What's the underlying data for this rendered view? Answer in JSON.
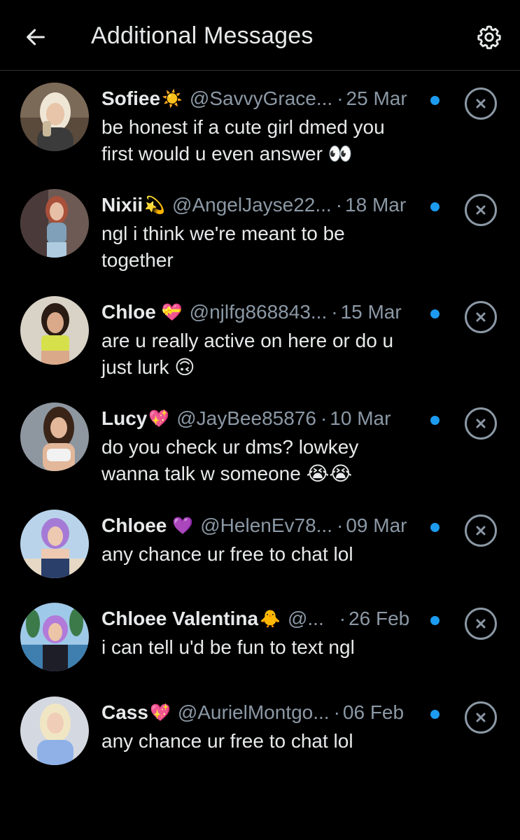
{
  "header": {
    "title": "Additional Messages",
    "back_icon": "arrow-left-icon",
    "settings_icon": "gear-icon"
  },
  "colors": {
    "background": "#000000",
    "text": "#e7e9ea",
    "secondary": "#8b98a5",
    "unread": "#1d9bf0"
  },
  "messages": [
    {
      "name": "Sofiee",
      "emoji": "☀️",
      "handle": "@SavvyGrace...",
      "date": "25 Mar",
      "text": "be honest if a cute girl dmed you first would u even answer 👀",
      "unread": true
    },
    {
      "name": "Nixii",
      "emoji": "💫",
      "handle": "@AngelJayse22...",
      "date": "18 Mar",
      "text": "ngl i think we're meant to be together",
      "unread": true
    },
    {
      "name": "Chloe",
      "emoji": "💝",
      "handle": "@njlfg868843...",
      "date": "15 Mar",
      "text": "are u really active on here or do u just lurk 🙃",
      "unread": true
    },
    {
      "name": "Lucy",
      "emoji": "💖",
      "handle": "@JayBee85876",
      "date": "10 Mar",
      "text": "do you check ur dms? lowkey wanna talk w someone 😭😭",
      "unread": true
    },
    {
      "name": "Chloee",
      "emoji": "💜",
      "handle": "@HelenEv78...",
      "date": "09 Mar",
      "text": "any chance ur free to chat lol",
      "unread": true
    },
    {
      "name": "Chloee Valentina",
      "emoji": "🐥",
      "handle": "@...",
      "date": "26 Feb",
      "text": "i can tell u'd be fun to text ngl",
      "unread": true
    },
    {
      "name": "Cass",
      "emoji": "💖",
      "handle": "@AurielMontgo...",
      "date": "06 Feb",
      "text": "any chance ur free to chat lol",
      "unread": true
    }
  ]
}
